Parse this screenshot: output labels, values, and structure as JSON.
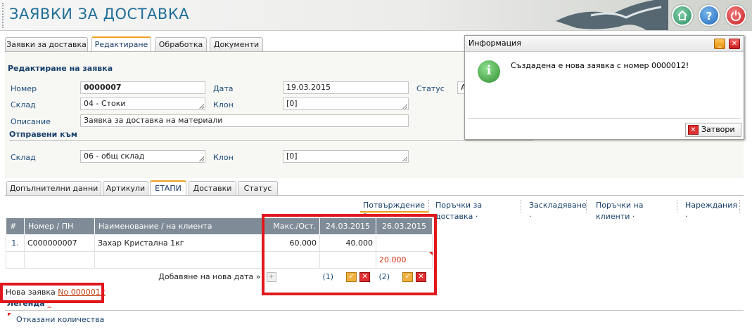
{
  "app_title": "ЗАЯВКИ ЗА ДОСТАВКА",
  "header_buttons": {
    "home_icon": "home-icon",
    "help": "?",
    "power_icon": "power-icon"
  },
  "tabs": [
    "Заявки за доставка",
    "Редактиране",
    "Обработка",
    "Документи"
  ],
  "active_tab": "Редактиране",
  "form": {
    "section_title": "Редактиране на заявка",
    "number_label": "Номер",
    "number_value": "0000007",
    "date_label": "Дата",
    "date_value": "19.03.2015",
    "status_label": "Статус",
    "status_value": "А",
    "warehouse_label": "Склад",
    "warehouse_value": "04 - Стоки",
    "branch_label": "Клон",
    "branch_value": "[0]",
    "description_label": "Описание",
    "description_value": "Заявка за доставка на материали",
    "sent_to_title": "Отправени към",
    "sent_warehouse_label": "Склад",
    "sent_warehouse_value": "06 - общ склад",
    "sent_branch_label": "Клон",
    "sent_branch_value": "[0]"
  },
  "inner_tabs": [
    "Допълнителни данни",
    "Артикули",
    "ЕТАПИ",
    "Доставки",
    "Статус"
  ],
  "active_inner_tab": "ЕТАПИ",
  "stage_tabs": [
    "Потвърждение °",
    "Поръчки за доставка ·",
    "Заскладяване ·",
    "Поръчки на клиенти ·",
    "Нареждания ·"
  ],
  "grid": {
    "headers": [
      "#",
      "Номер / ПН",
      "Наименование / на клиента",
      "Макс./Ост.",
      "24.03.2015",
      "26.03.2015"
    ],
    "rows": [
      {
        "num": "1.",
        "code": "C000000007",
        "name": "Захар Кристална 1кг",
        "max": "60.000",
        "d1": "40.000",
        "d2": ""
      },
      {
        "num": "",
        "code": "",
        "name": "",
        "max": "",
        "d1": "",
        "d2": "20.000"
      }
    ],
    "add_date_label": "Добавяне на нова дата »",
    "col1_count": "(1)",
    "col2_count": "(2)",
    "confirm_symbol": "✓",
    "reject_symbol": "✕"
  },
  "new_request": {
    "label": "Нова заявка",
    "link": "No 0000012"
  },
  "legend": {
    "title": "Легенда",
    "item": "Отказани количества"
  },
  "dialog": {
    "title": "Информация",
    "message": "Създадена е нова заявка с номер 0000012!",
    "close_label": "Затвори",
    "info_symbol": "i",
    "minimize_symbol": "_",
    "close_symbol": "✕"
  },
  "colors": {
    "accent": "#1e6e96",
    "active_tab": "#f0a020",
    "grid_header": "#7f8b96",
    "highlight": "#e0181e"
  }
}
